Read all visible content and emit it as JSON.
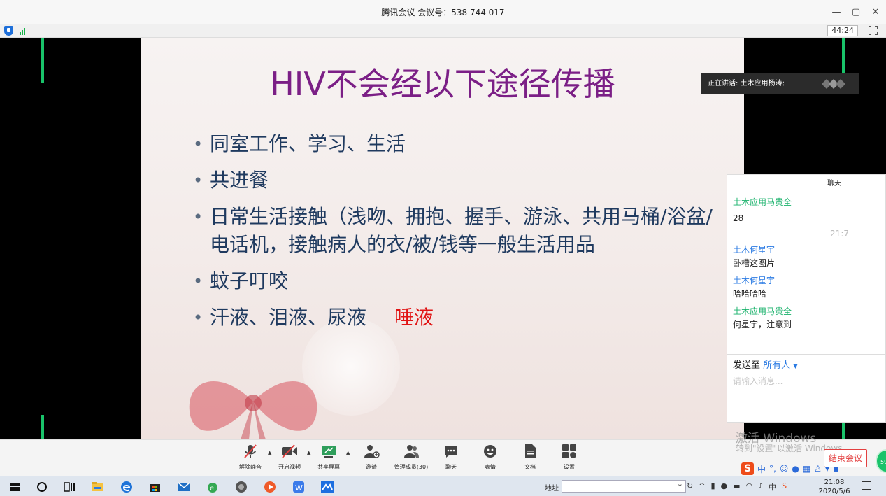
{
  "window": {
    "title": "腾讯会议 会议号：538 744 017",
    "minimize": "—",
    "restore": "▢",
    "close": "✕"
  },
  "status": {
    "timer": "44:24"
  },
  "slide": {
    "title": "HIV不会经以下途径传播",
    "bullets": [
      "同室工作、学习、生活",
      "共进餐",
      "日常生活接触（浅吻、拥抱、握手、游泳、共用马桶/浴盆/电话机，接触病人的衣/被/钱等一般生活用品",
      "蚊子叮咬",
      "汗液、泪液、尿液"
    ],
    "highlight": "唾液"
  },
  "speaking": {
    "label": "正在讲话: 土木应用杨涛;"
  },
  "chat": {
    "header": "聊天",
    "messages": [
      {
        "sender": "土木应用马贵全",
        "text": "28"
      },
      {
        "time": "21:7"
      },
      {
        "sender": "土木何星宇",
        "text": "卧槽这图片"
      },
      {
        "sender": "土木何星宇",
        "text": "哈哈哈哈"
      },
      {
        "sender": "土木应用马贵全",
        "text": "何星宇，注意到"
      }
    ],
    "send_to_label": "发送至",
    "send_to_target": "所有人",
    "input_placeholder": "请输入消息..."
  },
  "toolbar": {
    "items": [
      {
        "label": "解除静音",
        "icon": "mic-muted-icon"
      },
      {
        "label": "开启视频",
        "icon": "video-off-icon"
      },
      {
        "label": "共享屏幕",
        "icon": "share-screen-icon"
      },
      {
        "label": "邀请",
        "icon": "invite-icon"
      },
      {
        "label": "管理成员(30)",
        "icon": "members-icon"
      },
      {
        "label": "聊天",
        "icon": "chat-icon"
      },
      {
        "label": "表情",
        "icon": "emoji-icon"
      },
      {
        "label": "文档",
        "icon": "document-icon"
      },
      {
        "label": "设置",
        "icon": "settings-icon"
      }
    ],
    "end_meeting": "结束会议"
  },
  "watermark": {
    "line1": "激活 Windows",
    "line2": "转到\"设置\"以激活 Windows。"
  },
  "badge": {
    "value": "59"
  },
  "ime": {
    "logo": "S",
    "mode": "中",
    "punct": "°,"
  },
  "taskbar": {
    "address_label": "地址",
    "clock_time": "21:08",
    "clock_date": "2020/5/6",
    "tray_lang": "中"
  },
  "colors": {
    "accent_green": "#19c36a",
    "slide_title": "#7b1f86",
    "slide_text": "#1f3a5f",
    "highlight_red": "#e11414",
    "chat_green": "#19b26b",
    "chat_blue": "#2b7be3",
    "end_red": "#e34040"
  }
}
